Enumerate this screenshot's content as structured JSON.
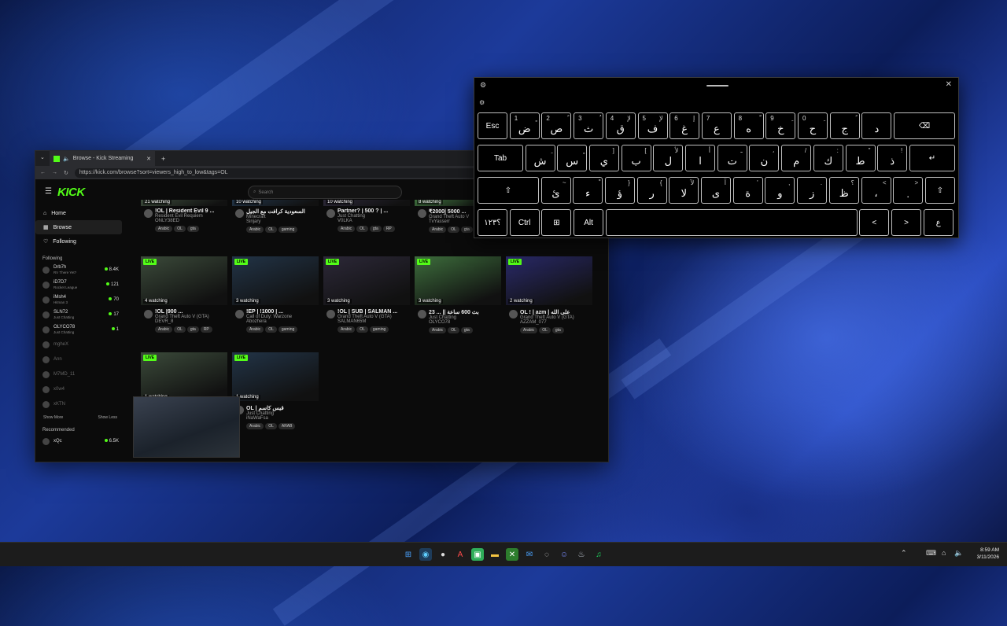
{
  "browser": {
    "tab_title": "Browse - Kick Streaming",
    "new_tab": "+",
    "close_tab": "✕",
    "url": "https://kick.com/browse?sort=viewers_high_to_low&tags=OL"
  },
  "site": {
    "logo": "KICK",
    "search_placeholder": "Search",
    "nav": [
      {
        "label": "Home",
        "icon": "home-icon"
      },
      {
        "label": "Browse",
        "icon": "browse-icon"
      },
      {
        "label": "Following",
        "icon": "heart-icon"
      }
    ],
    "following_title": "Following",
    "following": [
      {
        "name": "Drb7h",
        "game": "RV There Yet?",
        "count": "8.4K"
      },
      {
        "name": "iD7D7",
        "game": "Rocket League",
        "count": "121"
      },
      {
        "name": "iMsh4",
        "game": "Hitman 3",
        "count": "70"
      },
      {
        "name": "SLN72",
        "game": "Just Chatting",
        "count": "17"
      },
      {
        "name": "OLYCO78",
        "game": "Just Chatting",
        "count": "1"
      },
      {
        "name": "mgheX",
        "game": "",
        "count": ""
      },
      {
        "name": "Ann",
        "game": "",
        "count": ""
      },
      {
        "name": "M7MD_11",
        "game": "",
        "count": ""
      },
      {
        "name": "x0w4",
        "game": "",
        "count": ""
      },
      {
        "name": "xKTN",
        "game": "",
        "count": ""
      }
    ],
    "show_more": "Show More",
    "show_less": "Show Less",
    "recommended_title": "Recommended",
    "recommended": [
      {
        "name": "xQc",
        "count": "6.5K"
      }
    ]
  },
  "streams_top": [
    {
      "watching": "21 watching",
      "title": "!OL | Resident Evil 9 ...",
      "category": "Resident Evil Requiem",
      "channel": "ONLY38ED",
      "tags": [
        "Arabic",
        "OL",
        "gta"
      ]
    },
    {
      "watching": "10 watching",
      "title": "السعودية كرافت مع الجيل",
      "category": "Minecraft",
      "channel": "Sinjary",
      "tags": [
        "Arabic",
        "OL",
        "gaming"
      ]
    },
    {
      "watching": "10 watching",
      "title": "Partner? | 500 ? | ...",
      "category": "Just Chatting",
      "channel": "V0LKA",
      "tags": [
        "Arabic",
        "OL",
        "gta",
        "RP"
      ]
    },
    {
      "watching": "8 watching",
      "title": "₹2000| 5000 ...",
      "category": "Grand Theft Auto V",
      "channel": "TvYasserr",
      "tags": [
        "Arabic",
        "OL",
        "gta"
      ]
    }
  ],
  "streams_mid": [
    {
      "live": "LIVE",
      "watching": "4 watching",
      "title": "!OL |900 ...",
      "category": "Grand Theft Auto V (GTA)",
      "channel": "DEVR_8",
      "tags": [
        "Arabic",
        "OL",
        "gta",
        "RP"
      ]
    },
    {
      "live": "LIVE",
      "watching": "3 watching",
      "title": "!EP | !1000 | ...",
      "category": "Call of Duty: Warzone",
      "channel": "Abozhera",
      "tags": [
        "Arabic",
        "OL",
        "gaming"
      ]
    },
    {
      "live": "LIVE",
      "watching": "3 watching",
      "title": "!OL | SUB | SALMAN ...",
      "category": "Grand Theft Auto V (GTA)",
      "channel": "SALMAN65M",
      "tags": [
        "Arabic",
        "OL",
        "gaming"
      ]
    },
    {
      "live": "LIVE",
      "watching": "3 watching",
      "title": "23 ... || بث 600 ساعة",
      "category": "Just Chatting",
      "channel": "OLYCO78",
      "tags": [
        "Arabic",
        "OL",
        "gta"
      ]
    },
    {
      "live": "LIVE",
      "watching": "2 watching",
      "title": "OL ! | azm | على الله",
      "category": "Grand Theft Auto V (GTA)",
      "channel": "AZZAM_077",
      "tags": [
        "Arabic",
        "OL",
        "gta"
      ]
    }
  ],
  "streams_bottom": [
    {
      "live": "LIVE",
      "watching": "1 watching",
      "title": "",
      "category": "",
      "channel": "",
      "tags": []
    },
    {
      "live": "LIVE",
      "watching": "1 watching",
      "title": "OL | قيس كاسم",
      "category": "Just Chatting",
      "channel": "iNaWaFsa",
      "tags": [
        "Arabic",
        "OL",
        "ARAB"
      ]
    }
  ],
  "keyboard": {
    "row1": [
      {
        "n": "1",
        "s": "ٍ",
        "m": "ض"
      },
      {
        "n": "2",
        "s": "ً",
        "m": "ص"
      },
      {
        "n": "3",
        "s": "ُ",
        "m": "ث"
      },
      {
        "n": "4",
        "s": "ﻹ",
        "m": "ق"
      },
      {
        "n": "5",
        "s": "ﻹ",
        "m": "ف"
      },
      {
        "n": "6",
        "s": "إ",
        "m": "غ"
      },
      {
        "n": "7",
        "s": "",
        "m": "ع"
      },
      {
        "n": "8",
        "s": "ّ",
        "m": "ه"
      },
      {
        "n": "9",
        "s": "ِ",
        "m": "خ"
      },
      {
        "n": "0",
        "s": "ِ",
        "m": "ح"
      },
      {
        "n": "",
        "s": "ً",
        "m": "ج"
      },
      {
        "n": "",
        "s": "",
        "m": "د"
      }
    ],
    "row2": [
      {
        "s": "ِ",
        "m": "ش"
      },
      {
        "s": "ٍ",
        "m": "س"
      },
      {
        "s": "]",
        "m": "ي"
      },
      {
        "s": "[",
        "m": "ب"
      },
      {
        "s": "ﻷ",
        "m": "ل"
      },
      {
        "s": "أ",
        "m": "ا"
      },
      {
        "s": "ـ",
        "m": "ت"
      },
      {
        "s": "،",
        "m": "ن"
      },
      {
        "s": "/",
        "m": "م"
      },
      {
        "s": ":",
        "m": "ك"
      },
      {
        "s": "\"",
        "m": "ط"
      },
      {
        "s": "!",
        "m": "ذ"
      }
    ],
    "row3": [
      {
        "s": "~",
        "m": "ئ"
      },
      {
        "s": "ْ",
        "m": "ء"
      },
      {
        "s": "}",
        "m": "ؤ"
      },
      {
        "s": "{",
        "m": "ر"
      },
      {
        "s": "ﻵ",
        "m": "لا"
      },
      {
        "s": "آ",
        "m": "ى"
      },
      {
        "s": "'",
        "m": "ة"
      },
      {
        "s": ",",
        "m": "و"
      },
      {
        "s": ".",
        "m": "ز"
      },
      {
        "s": "؟",
        "m": "ظ"
      },
      {
        "s": "<",
        "m": "،"
      },
      {
        "s": ">",
        "m": "."
      }
    ],
    "esc": "Esc",
    "tab": "Tab",
    "symbols": "؟١٢٣",
    "ctrl": "Ctrl",
    "alt": "Alt",
    "lang_key": "ع",
    "left": "<",
    "right": ">"
  },
  "taskbar": {
    "time": "8:59 AM",
    "date": "3/11/2026"
  }
}
